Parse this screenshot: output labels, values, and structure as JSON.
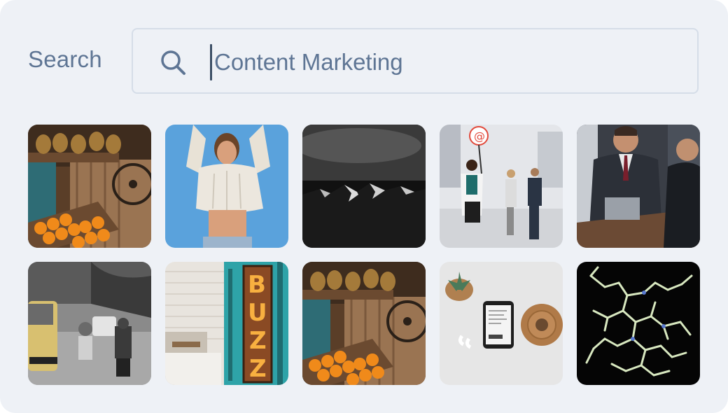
{
  "search": {
    "label": "Search",
    "value": "Content Marketing",
    "icon": "search-icon"
  },
  "colors": {
    "panel_bg": "#eef1f6",
    "text": "#5e7594",
    "border": "#d5dde8"
  },
  "results": [
    {
      "icon": "fruit-stand-image"
    },
    {
      "icon": "woman-sweater-image"
    },
    {
      "icon": "dark-mountains-image"
    },
    {
      "icon": "business-people-email-sign-image"
    },
    {
      "icon": "business-meeting-image"
    },
    {
      "icon": "street-scene-image"
    },
    {
      "icon": "buzz-neon-sign-image"
    },
    {
      "icon": "fruit-stand-image"
    },
    {
      "icon": "phone-on-desk-image"
    },
    {
      "icon": "molecule-structure-image"
    }
  ]
}
